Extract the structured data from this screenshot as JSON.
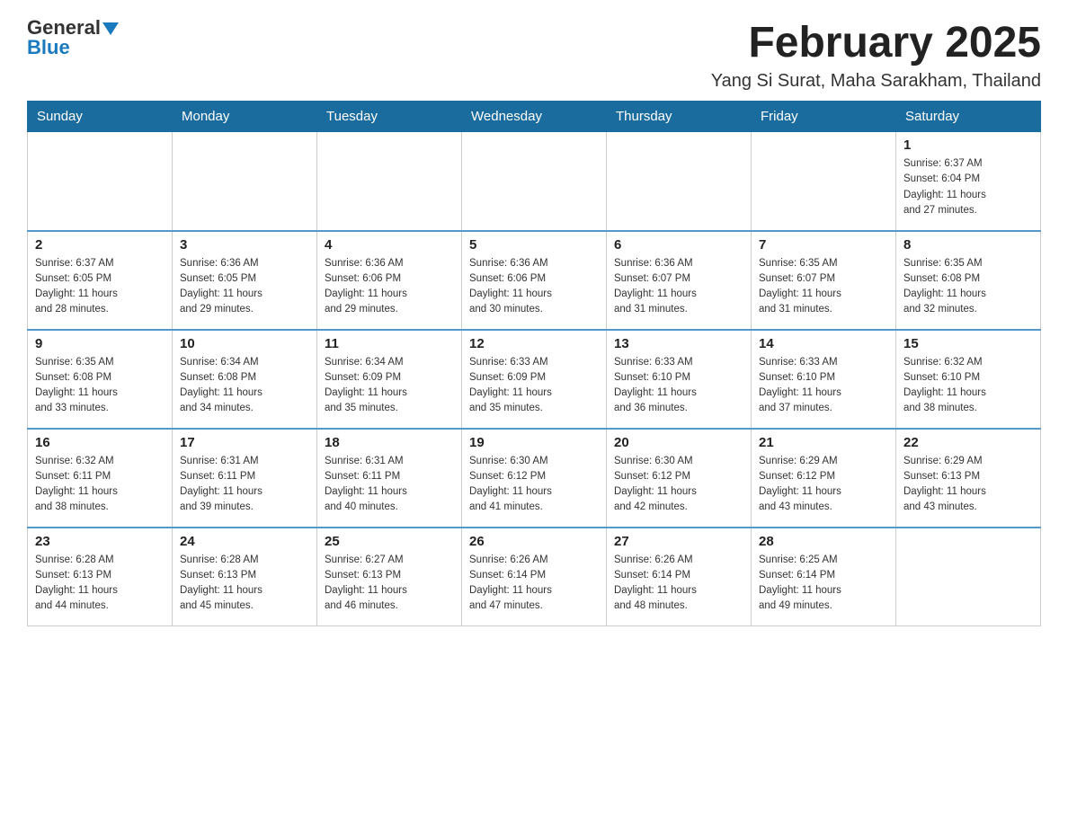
{
  "header": {
    "logo_general": "General",
    "logo_blue": "Blue",
    "title": "February 2025",
    "subtitle": "Yang Si Surat, Maha Sarakham, Thailand"
  },
  "days_of_week": [
    "Sunday",
    "Monday",
    "Tuesday",
    "Wednesday",
    "Thursday",
    "Friday",
    "Saturday"
  ],
  "weeks": [
    [
      {
        "day": "",
        "info": ""
      },
      {
        "day": "",
        "info": ""
      },
      {
        "day": "",
        "info": ""
      },
      {
        "day": "",
        "info": ""
      },
      {
        "day": "",
        "info": ""
      },
      {
        "day": "",
        "info": ""
      },
      {
        "day": "1",
        "info": "Sunrise: 6:37 AM\nSunset: 6:04 PM\nDaylight: 11 hours\nand 27 minutes."
      }
    ],
    [
      {
        "day": "2",
        "info": "Sunrise: 6:37 AM\nSunset: 6:05 PM\nDaylight: 11 hours\nand 28 minutes."
      },
      {
        "day": "3",
        "info": "Sunrise: 6:36 AM\nSunset: 6:05 PM\nDaylight: 11 hours\nand 29 minutes."
      },
      {
        "day": "4",
        "info": "Sunrise: 6:36 AM\nSunset: 6:06 PM\nDaylight: 11 hours\nand 29 minutes."
      },
      {
        "day": "5",
        "info": "Sunrise: 6:36 AM\nSunset: 6:06 PM\nDaylight: 11 hours\nand 30 minutes."
      },
      {
        "day": "6",
        "info": "Sunrise: 6:36 AM\nSunset: 6:07 PM\nDaylight: 11 hours\nand 31 minutes."
      },
      {
        "day": "7",
        "info": "Sunrise: 6:35 AM\nSunset: 6:07 PM\nDaylight: 11 hours\nand 31 minutes."
      },
      {
        "day": "8",
        "info": "Sunrise: 6:35 AM\nSunset: 6:08 PM\nDaylight: 11 hours\nand 32 minutes."
      }
    ],
    [
      {
        "day": "9",
        "info": "Sunrise: 6:35 AM\nSunset: 6:08 PM\nDaylight: 11 hours\nand 33 minutes."
      },
      {
        "day": "10",
        "info": "Sunrise: 6:34 AM\nSunset: 6:08 PM\nDaylight: 11 hours\nand 34 minutes."
      },
      {
        "day": "11",
        "info": "Sunrise: 6:34 AM\nSunset: 6:09 PM\nDaylight: 11 hours\nand 35 minutes."
      },
      {
        "day": "12",
        "info": "Sunrise: 6:33 AM\nSunset: 6:09 PM\nDaylight: 11 hours\nand 35 minutes."
      },
      {
        "day": "13",
        "info": "Sunrise: 6:33 AM\nSunset: 6:10 PM\nDaylight: 11 hours\nand 36 minutes."
      },
      {
        "day": "14",
        "info": "Sunrise: 6:33 AM\nSunset: 6:10 PM\nDaylight: 11 hours\nand 37 minutes."
      },
      {
        "day": "15",
        "info": "Sunrise: 6:32 AM\nSunset: 6:10 PM\nDaylight: 11 hours\nand 38 minutes."
      }
    ],
    [
      {
        "day": "16",
        "info": "Sunrise: 6:32 AM\nSunset: 6:11 PM\nDaylight: 11 hours\nand 38 minutes."
      },
      {
        "day": "17",
        "info": "Sunrise: 6:31 AM\nSunset: 6:11 PM\nDaylight: 11 hours\nand 39 minutes."
      },
      {
        "day": "18",
        "info": "Sunrise: 6:31 AM\nSunset: 6:11 PM\nDaylight: 11 hours\nand 40 minutes."
      },
      {
        "day": "19",
        "info": "Sunrise: 6:30 AM\nSunset: 6:12 PM\nDaylight: 11 hours\nand 41 minutes."
      },
      {
        "day": "20",
        "info": "Sunrise: 6:30 AM\nSunset: 6:12 PM\nDaylight: 11 hours\nand 42 minutes."
      },
      {
        "day": "21",
        "info": "Sunrise: 6:29 AM\nSunset: 6:12 PM\nDaylight: 11 hours\nand 43 minutes."
      },
      {
        "day": "22",
        "info": "Sunrise: 6:29 AM\nSunset: 6:13 PM\nDaylight: 11 hours\nand 43 minutes."
      }
    ],
    [
      {
        "day": "23",
        "info": "Sunrise: 6:28 AM\nSunset: 6:13 PM\nDaylight: 11 hours\nand 44 minutes."
      },
      {
        "day": "24",
        "info": "Sunrise: 6:28 AM\nSunset: 6:13 PM\nDaylight: 11 hours\nand 45 minutes."
      },
      {
        "day": "25",
        "info": "Sunrise: 6:27 AM\nSunset: 6:13 PM\nDaylight: 11 hours\nand 46 minutes."
      },
      {
        "day": "26",
        "info": "Sunrise: 6:26 AM\nSunset: 6:14 PM\nDaylight: 11 hours\nand 47 minutes."
      },
      {
        "day": "27",
        "info": "Sunrise: 6:26 AM\nSunset: 6:14 PM\nDaylight: 11 hours\nand 48 minutes."
      },
      {
        "day": "28",
        "info": "Sunrise: 6:25 AM\nSunset: 6:14 PM\nDaylight: 11 hours\nand 49 minutes."
      },
      {
        "day": "",
        "info": ""
      }
    ]
  ]
}
